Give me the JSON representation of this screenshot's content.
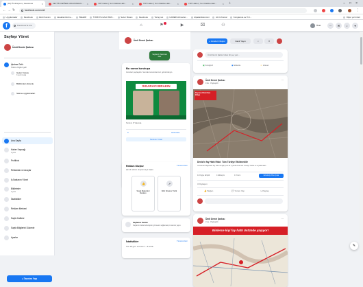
{
  "browser": {
    "tabs": [
      {
        "label": "(18) Ümit Eylem | Facebook"
      },
      {
        "label": "ZEYTİN DEĞER ANKASINDAN ..."
      },
      {
        "label": "TRT Haber | Son Dakika Hab..."
      },
      {
        "label": "TRT Haber | Son Dakika Hab..."
      },
      {
        "label": "TRT Haber | Son Dakika Hab..."
      }
    ],
    "url": "facebook.com/umit",
    "bookmarks": [
      "Uygulamalar",
      "Facebook",
      "Ekici Kanımı",
      "Hesabat Hizme...",
      "BELERİ",
      "TÜRKİYE HALK BAN...",
      "Sezer Botanı",
      "Facebook",
      "Twing.net",
      "HABER Hizmetler...",
      "Alpakat Ekonomi",
      "Atlı & Kumal",
      "Kongarova ev Ö.it...",
      "Diğer yer imleri"
    ]
  },
  "fb": {
    "search_placeholder": "Facebook'ta Ara",
    "profile_name": "Ümit",
    "nav_icons": [
      "home-icon",
      "flag-icon",
      "watch-icon",
      "marketplace-icon",
      "groups-icon"
    ]
  },
  "sidebar": {
    "title": "Sayfayı Yönet",
    "page_name": "Ümit Demir Şarkısı",
    "business": {
      "label": "İşletme Gelir",
      "sub": "Ödeme bilgileri gelir"
    },
    "sub_items": [
      {
        "label": "Gelen Kutusu",
        "sub": "3 yeni mesaj"
      },
      {
        "label": "Bildirimleri düzenle",
        "sub": ""
      },
      {
        "label": "Sekme uygulamaları",
        "sub": ""
      }
    ],
    "items": [
      {
        "label": "Ana Sayfa",
        "sub": ""
      },
      {
        "label": "Haber Kaynağı",
        "sub": "4 yeni"
      },
      {
        "label": "Profiliniz",
        "sub": ""
      },
      {
        "label": "Reklamlar ve Araçlar",
        "sub": ""
      },
      {
        "label": "İş İlanlarını Yönet",
        "sub": ""
      },
      {
        "label": "Bildirimler",
        "sub": "3 yeni"
      },
      {
        "label": "İstatistikler",
        "sub": ""
      },
      {
        "label": "Reklam Merkezi",
        "sub": ""
      },
      {
        "label": "Sayfa Kalitesi",
        "sub": ""
      },
      {
        "label": "Sayfa Bilgilerini Düzenle",
        "sub": ""
      },
      {
        "label": "Ayarlar",
        "sub": ""
      }
    ],
    "promote_label": "Tanıtım Yap"
  },
  "middle": {
    "page_name": "Ümit Demir Şarkısı",
    "ad_header": "Sayfanızı Tanıtmak Ister",
    "ad": {
      "title": "Bu sonra kuruluşa",
      "text": "Gönderi paylaşıldı. Sonraki tanıtımlarınızı görüntüleyin.",
      "banner": "SIGARAYI BIRAKIN",
      "footer_text": "Tanıtım 8 Yakında",
      "count": "0",
      "action": "Görüntüle",
      "button": "Tanıtımı Yönet"
    },
    "welcome": {
      "title": "Reklam Oluştur",
      "link": "Tümünü Gör",
      "sub": "Şimdi reklam oluşturmaya başla",
      "options": [
        {
          "label": "Sayfa Beğenileri Reklamı",
          "icon": "like-icon"
        },
        {
          "label": "Web Sitesine Trafik",
          "icon": "cursor-icon"
        }
      ]
    },
    "tip": {
      "title": "Sayfanızı Tanıtın",
      "text": "Sayfanızı daha fazla kişinin görmesini sağlamak için tanıtım yapın."
    },
    "stats": {
      "title": "İstatistikler",
      "link": "Tümünü Gör",
      "text": "Son 28 gün: 11 Kasım – 8 Aralık"
    }
  },
  "right": {
    "create_post_button": "Gönderi Oluştur",
    "live_button": "Canlı Yayın",
    "more_button": "Diğer",
    "composer": {
      "placeholder": "Ümit Demir Şarkısı'ndan bir şey yaz...",
      "actions": [
        "Fotoğraf",
        "Etiketle",
        "Hisset"
      ]
    },
    "post1": {
      "author": "Ümit Demir Şarkısı",
      "time": "9 dk · Paylaşıldı",
      "caption": "Deprem Riski Sarı Bölge",
      "title": "Deniz'in fay Hattı Riski: Tüm Türkiye Etkilenebilir",
      "text": "Uzmanlar bölgedeki fay hattı ile ilgili yeni bir uyarıda bulundu. Detaylı harita ve açıklamalar...",
      "stats": [
        "14 Kişiye Erişildi",
        "4 Etkileşim",
        "4 Yorum",
        "3 Paylaşım"
      ],
      "boost_button": "Gönderiyi Öne Çıkar",
      "reactions": [
        "Beğen",
        "Yorum Yap",
        "Paylaş"
      ]
    },
    "post2": {
      "author": "Ümit Demir Şarkısı",
      "time": "3 sa · Paylaşıldı",
      "headline": "Binlerce kişi fay hattı üstünde yaşıyor!",
      "reactions": [
        "Beğen",
        "Yorum Yap",
        "Paylaş"
      ]
    }
  },
  "colors": {
    "fb_blue": "#1877f2",
    "headline_red": "#d61f26",
    "page_bg": "#f0f2f5"
  }
}
